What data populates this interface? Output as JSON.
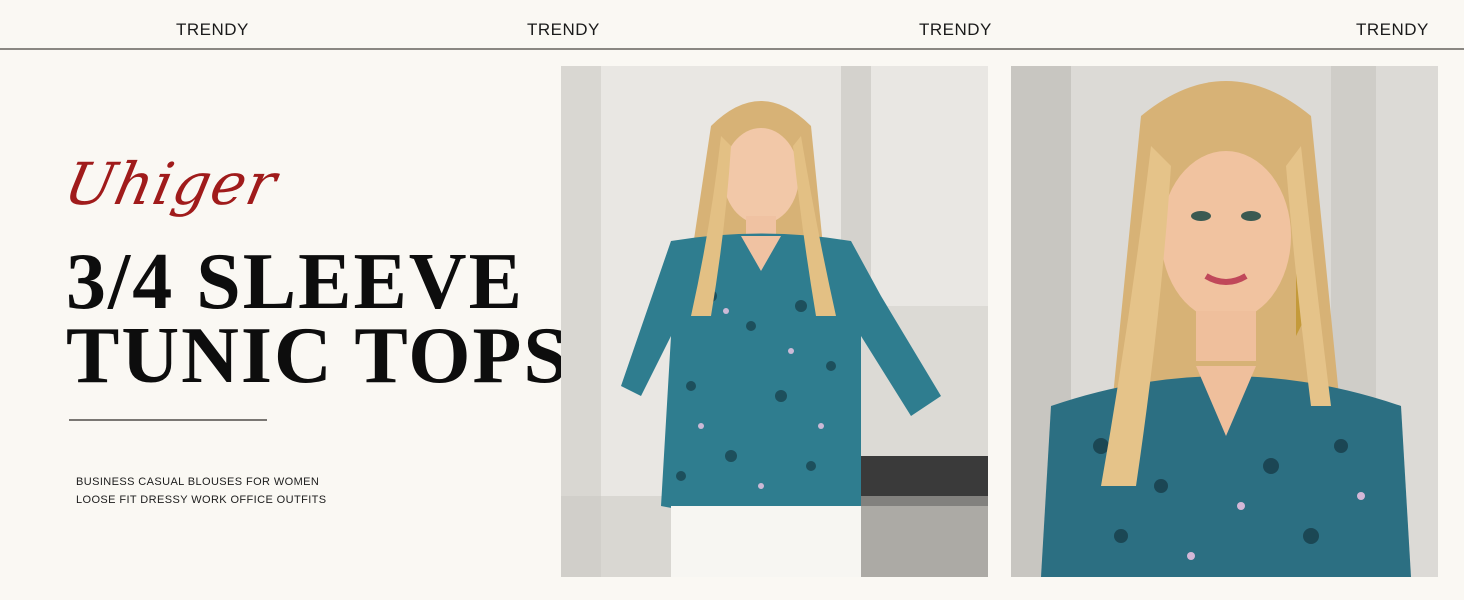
{
  "nav": {
    "tabs": [
      "TRENDY",
      "TRENDY",
      "TRENDY",
      "TRENDY"
    ]
  },
  "hero": {
    "brand": "Uhiger",
    "headline_line1": "3/4 SLEEVE",
    "headline_line2": "TUNIC TOPS",
    "subtitle_line1": "BUSINESS CASUAL BLOUSES FOR WOMEN",
    "subtitle_line2": "LOOSE FIT DRESSY WORK OFFICE OUTFITS"
  },
  "colors": {
    "background": "#faf8f3",
    "brand": "#a01b1b",
    "headline": "#0d0d0d",
    "blouse": "#2f7d8f",
    "hair": "#d9b77a"
  },
  "images": [
    {
      "name": "model-full-view-photo"
    },
    {
      "name": "model-closeup-photo"
    }
  ]
}
